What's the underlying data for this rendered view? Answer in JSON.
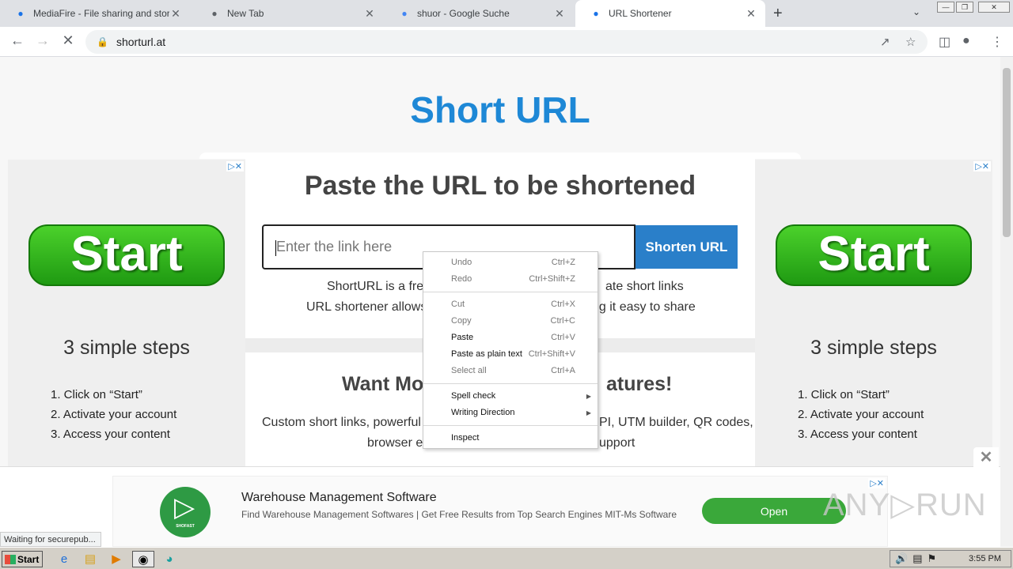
{
  "browser": {
    "tabs": [
      {
        "title": "MediaFire - File sharing and storage m",
        "icon": "mediafire-icon",
        "color": "#1a73e8"
      },
      {
        "title": "New Tab",
        "icon": "chrome-icon",
        "color": "#5f6368"
      },
      {
        "title": "shuor - Google Suche",
        "icon": "google-icon",
        "color": "#4285f4"
      },
      {
        "title": "URL Shortener",
        "icon": "shorturl-icon",
        "color": "#1a73e8"
      }
    ],
    "active_tab": 3,
    "address": "shorturl.at"
  },
  "page": {
    "brand": "Short URL",
    "heading": "Paste the URL to be shortened",
    "input_placeholder": "Enter the link here",
    "shorten_button": "Shorten URL",
    "desc_line1": "ShortURL is a free",
    "desc_line1_right": "ate short links",
    "desc_line2": "URL shortener allows",
    "desc_line2_right": "ng it easy to share",
    "more_title_left": "Want Mo",
    "more_title_right": "atures!",
    "more_text_line1_left": "Custom short links, powerful",
    "more_text_line1_right": "PI, UTM builder, QR codes,",
    "more_text_line2_left": "browser ex",
    "more_text_line2_right": "upport"
  },
  "side_ad": {
    "start_label": "Start",
    "steps_title": "3 simple steps",
    "steps": [
      "1. Click on “Start”",
      "2. Activate your account",
      "3. Access your content"
    ],
    "badge": "▷✕"
  },
  "context_menu": {
    "groups": [
      [
        {
          "label": "Undo",
          "shortcut": "Ctrl+Z",
          "disabled": true
        },
        {
          "label": "Redo",
          "shortcut": "Ctrl+Shift+Z",
          "disabled": true
        }
      ],
      [
        {
          "label": "Cut",
          "shortcut": "Ctrl+X",
          "disabled": true
        },
        {
          "label": "Copy",
          "shortcut": "Ctrl+C",
          "disabled": true
        },
        {
          "label": "Paste",
          "shortcut": "Ctrl+V",
          "disabled": false
        },
        {
          "label": "Paste as plain text",
          "shortcut": "Ctrl+Shift+V",
          "disabled": false
        },
        {
          "label": "Select all",
          "shortcut": "Ctrl+A",
          "disabled": true
        }
      ],
      [
        {
          "label": "Spell check",
          "shortcut": "",
          "submenu": true
        },
        {
          "label": "Writing Direction",
          "shortcut": "",
          "submenu": true
        }
      ],
      [
        {
          "label": "Inspect",
          "shortcut": ""
        }
      ]
    ]
  },
  "bottom_ad": {
    "logo_text": "SHOFAST",
    "title": "Warehouse Management Software",
    "description": "Find Warehouse Management Softwares | Get Free Results from Top Search Engines MIT-Ms Software",
    "open_label": "Open",
    "close_label": "✕"
  },
  "watermark": "ANY▷RUN",
  "status_text": "Waiting for securepub...",
  "taskbar": {
    "start_label": "Start",
    "clock": "3:55 PM"
  }
}
